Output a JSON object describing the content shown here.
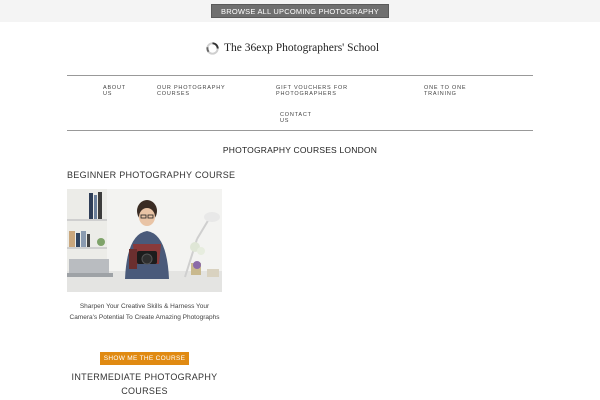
{
  "topbar": {
    "browse_label": "BROWSE ALL UPCOMING PHOTOGRAPHY COURSES"
  },
  "brand": {
    "logo_icon": "aperture-ring-icon",
    "name": "The 36exp Photographers' School"
  },
  "nav": {
    "items": [
      {
        "label": "ABOUT US"
      },
      {
        "label": "OUR PHOTOGRAPHY COURSES"
      },
      {
        "label": "GIFT VOUCHERS FOR PHOTOGRAPHERS"
      },
      {
        "label": "ONE TO ONE TRAINING"
      },
      {
        "label": "CONTACT US"
      }
    ]
  },
  "main": {
    "page_title": "PHOTOGRAPHY COURSES LONDON",
    "courses": [
      {
        "title": "BEGINNER PHOTOGRAPHY COURSE",
        "description": "Sharpen Your Creative Skills & Harness Your Camera's Potential To Create Amazing Photographs",
        "cta_label": "SHOW ME THE COURSE"
      },
      {
        "title": "INTERMEDIATE PHOTOGRAPHY COURSES"
      }
    ]
  },
  "colors": {
    "accent": "#e08a12",
    "browse_button": "#6f6f6f",
    "rule": "#999999"
  }
}
